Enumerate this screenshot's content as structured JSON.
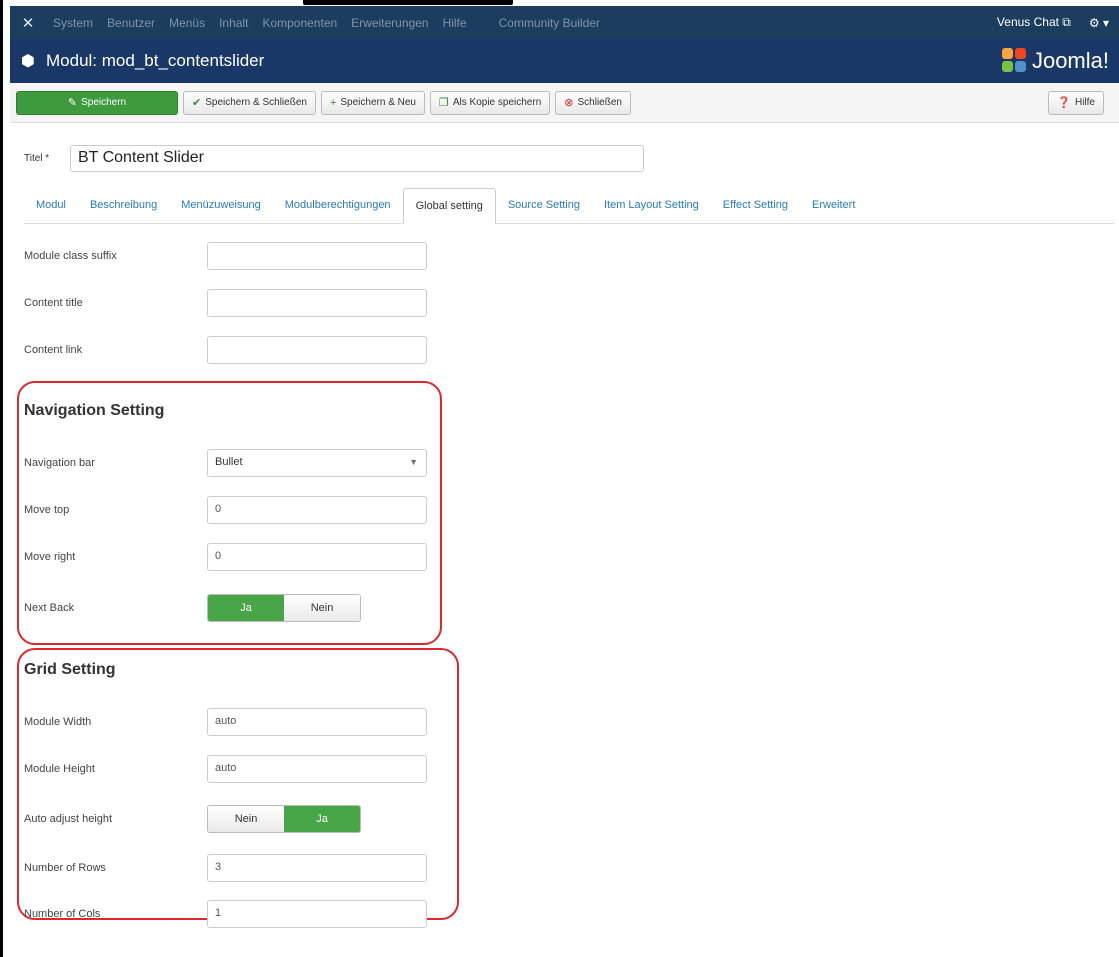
{
  "navbar": {
    "menu": [
      "System",
      "Benutzer",
      "Menüs",
      "Inhalt",
      "Komponenten",
      "Erweiterungen",
      "Hilfe",
      "Community Builder"
    ],
    "chat": "Venus Chat ⧉",
    "settings": "⚙ ▾"
  },
  "header": {
    "title": "Modul: mod_bt_contentslider",
    "brand": "Joomla!"
  },
  "toolbar": {
    "save": "Speichern",
    "save_close": "Speichern & Schließen",
    "save_new": "Speichern & Neu",
    "save_copy": "Als Kopie speichern",
    "close": "Schließen",
    "help": "Hilfe"
  },
  "title_field": {
    "label": "Titel *",
    "value": "BT Content Slider"
  },
  "tabs": [
    "Modul",
    "Beschreibung",
    "Menüzuweisung",
    "Modulberechtigungen",
    "Global setting",
    "Source Setting",
    "Item Layout Setting",
    "Effect Setting",
    "Erweitert"
  ],
  "global": {
    "class_suffix": {
      "label": "Module class suffix",
      "value": ""
    },
    "content_title": {
      "label": "Content title",
      "value": ""
    },
    "content_link": {
      "label": "Content link",
      "value": ""
    }
  },
  "navigation": {
    "heading": "Navigation Setting",
    "nav_bar": {
      "label": "Navigation bar",
      "value": "Bullet"
    },
    "move_top": {
      "label": "Move top",
      "value": "0"
    },
    "move_right": {
      "label": "Move right",
      "value": "0"
    },
    "next_back": {
      "label": "Next Back",
      "yes": "Ja",
      "no": "Nein"
    }
  },
  "grid": {
    "heading": "Grid Setting",
    "width": {
      "label": "Module Width",
      "value": "auto"
    },
    "height": {
      "label": "Module Height",
      "value": "auto"
    },
    "auto_adjust": {
      "label": "Auto adjust height",
      "no": "Nein",
      "yes": "Ja"
    },
    "rows": {
      "label": "Number of Rows",
      "value": "3"
    },
    "cols": {
      "label": "Number of Cols",
      "value": "1"
    }
  },
  "colors": {
    "navbar": "#1b3e5f",
    "header": "#1a3867",
    "accent": "#48a648",
    "highlight": "#e0262e",
    "link": "#2a7ab8"
  }
}
